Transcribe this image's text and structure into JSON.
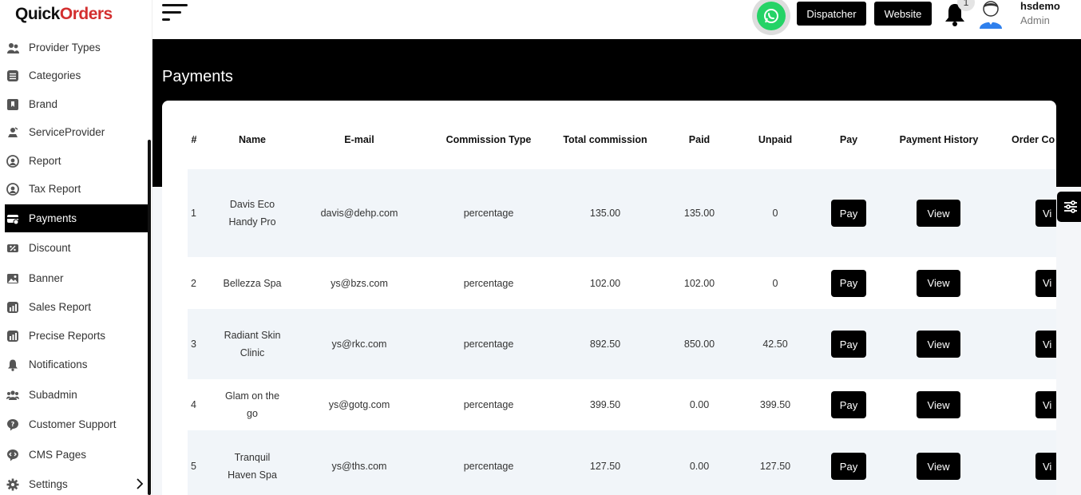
{
  "brand": {
    "part1": "Quick",
    "part2": "Orders"
  },
  "sidebar": {
    "items": [
      {
        "label": "Provider Types",
        "icon": "users-icon"
      },
      {
        "label": "Categories",
        "icon": "list-icon"
      },
      {
        "label": "Brand",
        "icon": "bookmark-icon"
      },
      {
        "label": "ServiceProvider",
        "icon": "service-icon"
      },
      {
        "label": "Report",
        "icon": "report-icon"
      },
      {
        "label": "Tax Report",
        "icon": "tax-icon"
      },
      {
        "label": "Payments",
        "icon": "payments-icon"
      },
      {
        "label": "Discount",
        "icon": "discount-icon"
      },
      {
        "label": "Banner",
        "icon": "image-icon"
      },
      {
        "label": "Sales Report",
        "icon": "chart-icon"
      },
      {
        "label": "Precise Reports",
        "icon": "chart-icon"
      },
      {
        "label": "Notifications",
        "icon": "bell-icon"
      },
      {
        "label": "Subadmin",
        "icon": "group-icon"
      },
      {
        "label": "Customer Support",
        "icon": "chat-icon"
      },
      {
        "label": "CMS Pages",
        "icon": "code-icon"
      },
      {
        "label": "Settings",
        "icon": "gear-icon"
      }
    ],
    "active": "Payments"
  },
  "header": {
    "dispatcher_label": "Dispatcher",
    "website_label": "Website",
    "notification_count": "1",
    "user_name": "hsdemo",
    "user_role": "Admin"
  },
  "page": {
    "title": "Payments"
  },
  "table": {
    "columns": [
      "#",
      "Name",
      "E-mail",
      "Commission Type",
      "Total commission",
      "Paid",
      "Unpaid",
      "Pay",
      "Payment History",
      "Order Co"
    ],
    "pay_label": "Pay",
    "view_label": "View",
    "view_partial_label": "Vi",
    "rows": [
      {
        "num": "1",
        "name": "Davis Eco Handy Pro",
        "email": "davis@dehp.com",
        "type": "percentage",
        "total": "135.00",
        "paid": "135.00",
        "unpaid": "0"
      },
      {
        "num": "2",
        "name": "Bellezza Spa",
        "email": "ys@bzs.com",
        "type": "percentage",
        "total": "102.00",
        "paid": "102.00",
        "unpaid": "0"
      },
      {
        "num": "3",
        "name": "Radiant Skin Clinic",
        "email": "ys@rkc.com",
        "type": "percentage",
        "total": "892.50",
        "paid": "850.00",
        "unpaid": "42.50"
      },
      {
        "num": "4",
        "name": "Glam on the go",
        "email": "ys@gotg.com",
        "type": "percentage",
        "total": "399.50",
        "paid": "0.00",
        "unpaid": "399.50"
      },
      {
        "num": "5",
        "name": "Tranquil Haven Spa",
        "email": "ys@ths.com",
        "type": "percentage",
        "total": "127.50",
        "paid": "0.00",
        "unpaid": "127.50"
      }
    ]
  }
}
